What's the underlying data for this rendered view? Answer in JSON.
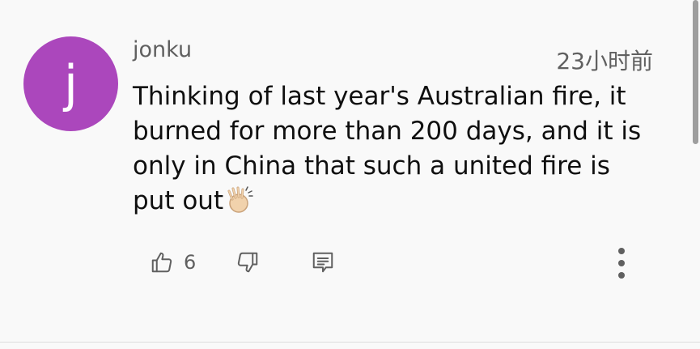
{
  "comment": {
    "avatar_letter": "j",
    "avatar_color": "#ab47bc",
    "author": "jonku",
    "timestamp": "23小时前",
    "text": "Thinking of last year's Australian fire, it burned for more than 200 days, and it is only in China that such a united fire is put out",
    "emoji_icon": "clapping-hands-icon"
  },
  "actions": {
    "like_icon": "thumbs-up-icon",
    "like_count": "6",
    "dislike_icon": "thumbs-down-icon",
    "reply_icon": "reply-comment-icon",
    "more_icon": "more-vertical-icon"
  }
}
